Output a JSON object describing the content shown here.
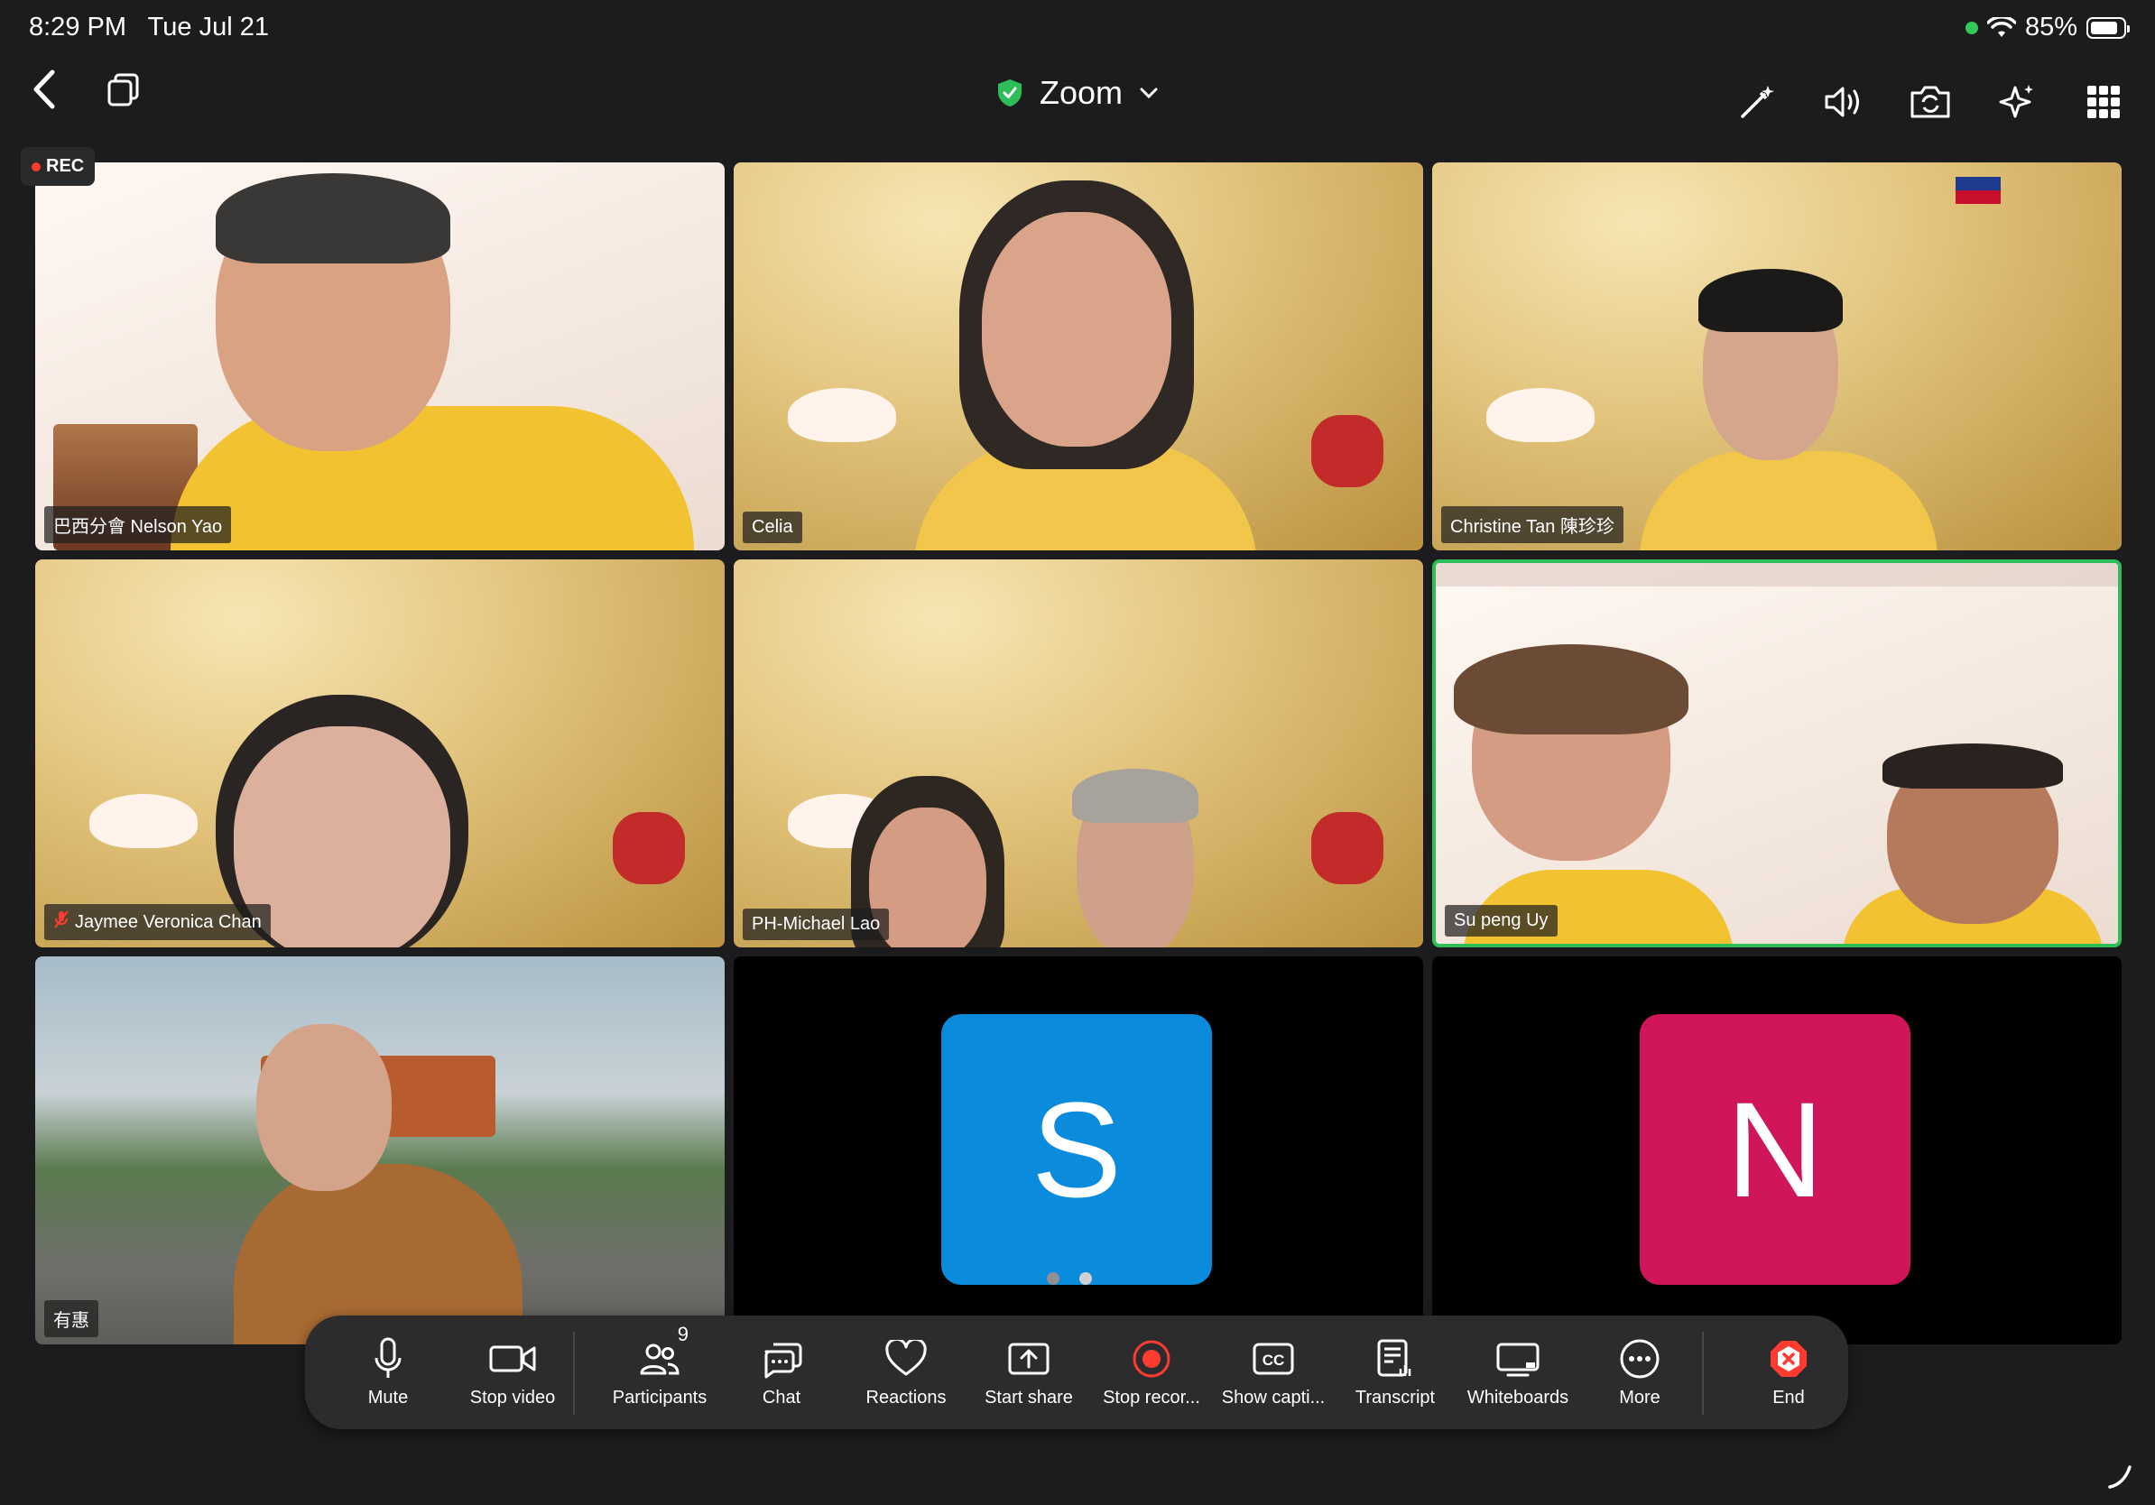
{
  "status_bar": {
    "time": "8:29 PM",
    "date": "Tue Jul 21",
    "battery": "85%",
    "battery_level": 0.85
  },
  "toolbar": {
    "title": "Zoom"
  },
  "recording": {
    "label": "REC"
  },
  "tiles": [
    {
      "name": "巴西分會 Nelson Yao",
      "muted": false
    },
    {
      "name": "Celia",
      "muted": false
    },
    {
      "name": "Christine Tan 陳珍珍",
      "muted": false
    },
    {
      "name": "Jaymee Veronica Chan",
      "muted": true
    },
    {
      "name": "PH-Michael Lao",
      "muted": false
    },
    {
      "name": "Su peng Uy",
      "muted": false
    },
    {
      "name": "有惠",
      "muted": false
    },
    {
      "initial": "S",
      "color": "#0b8bdc"
    },
    {
      "initial": "N",
      "color": "#d0155a"
    }
  ],
  "pagination": {
    "pages": 2,
    "current": 2
  },
  "bottom_bar": {
    "mute": "Mute",
    "stop_video": "Stop video",
    "participants": "Participants",
    "participants_count": "9",
    "chat": "Chat",
    "reactions": "Reactions",
    "start_share": "Start share",
    "stop_recording": "Stop recor...",
    "show_captions": "Show capti...",
    "transcript": "Transcript",
    "whiteboards": "Whiteboards",
    "more": "More",
    "end": "End"
  },
  "colors": {
    "active_speaker": "#2ebd59",
    "recording": "#ff3b30",
    "end": "#ff3b30",
    "background": "#1c1c1e"
  }
}
